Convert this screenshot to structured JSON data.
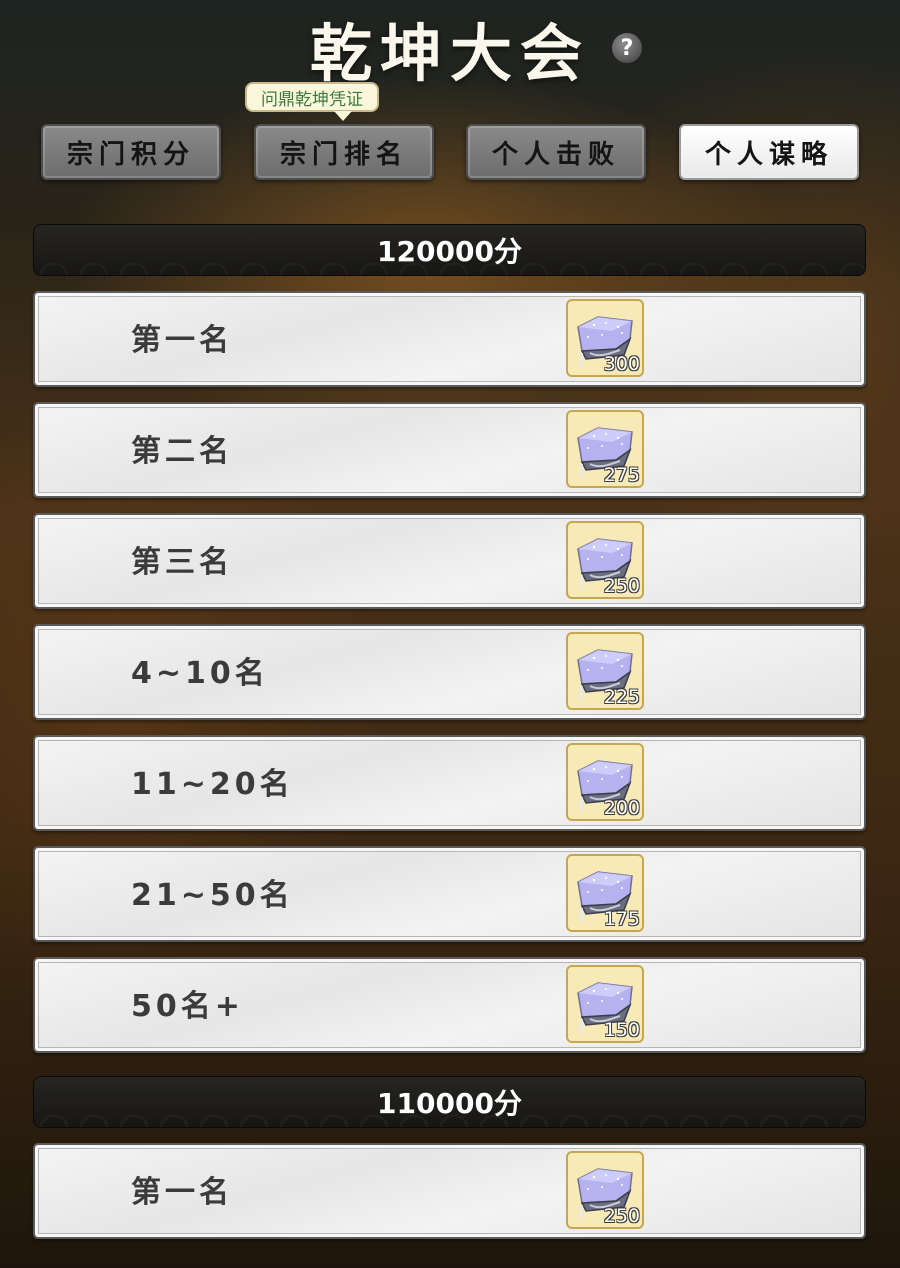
{
  "title": "乾坤大会",
  "help_icon": "question-icon",
  "tooltip": "问鼎乾坤凭证",
  "tabs": [
    {
      "label": "宗门积分",
      "active": false
    },
    {
      "label": "宗门排名",
      "active": false
    },
    {
      "label": "个人击败",
      "active": false
    },
    {
      "label": "个人谋略",
      "active": true
    }
  ],
  "sections": [
    {
      "score": "120000分",
      "rows": [
        {
          "rank": "第一名",
          "reward_icon": "spirit-crystal-icon",
          "count": "300"
        },
        {
          "rank": "第二名",
          "reward_icon": "spirit-crystal-icon",
          "count": "275"
        },
        {
          "rank": "第三名",
          "reward_icon": "spirit-crystal-icon",
          "count": "250"
        },
        {
          "rank": "4~10名",
          "reward_icon": "spirit-crystal-icon",
          "count": "225"
        },
        {
          "rank": "11~20名",
          "reward_icon": "spirit-crystal-icon",
          "count": "200"
        },
        {
          "rank": "21~50名",
          "reward_icon": "spirit-crystal-icon",
          "count": "175"
        },
        {
          "rank": "50名+",
          "reward_icon": "spirit-crystal-icon",
          "count": "150"
        }
      ]
    },
    {
      "score": "110000分",
      "rows": [
        {
          "rank": "第一名",
          "reward_icon": "spirit-crystal-icon",
          "count": "250"
        }
      ]
    }
  ]
}
